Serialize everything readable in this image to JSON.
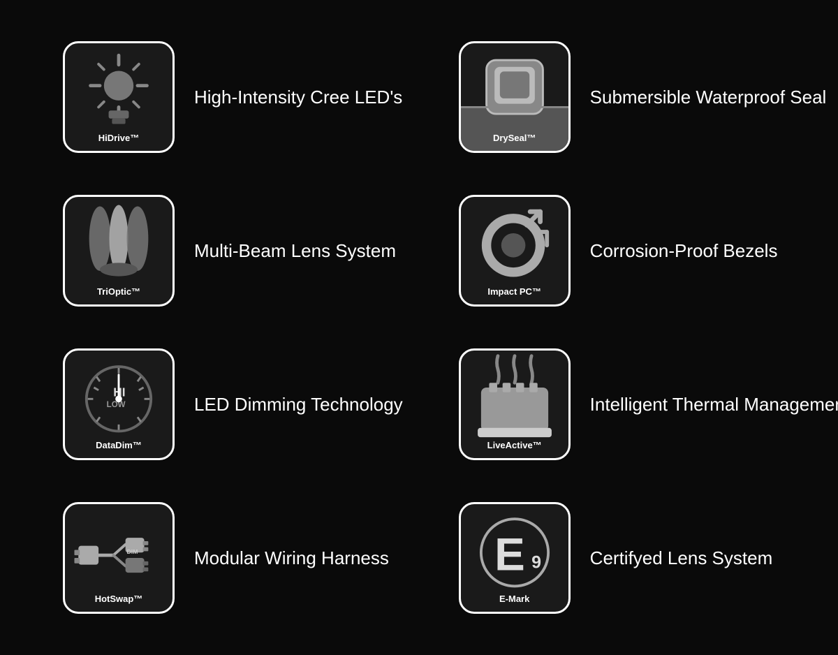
{
  "features": [
    {
      "id": "hidrive",
      "brand": "HiDrive™",
      "description": "High-Intensity Cree LED's"
    },
    {
      "id": "dryseal",
      "brand": "DrySeal™",
      "description": "Submersible Waterproof Seal"
    },
    {
      "id": "trioptic",
      "brand": "TriOptic™",
      "description": "Multi-Beam Lens System"
    },
    {
      "id": "impactpc",
      "brand": "Impact PC™",
      "description": "Corrosion-Proof Bezels"
    },
    {
      "id": "datadim",
      "brand": "DataDim™",
      "description": "LED Dimming Technology"
    },
    {
      "id": "liveactive",
      "brand": "LiveActive™",
      "description": "Intelligent Thermal Management"
    },
    {
      "id": "hotswap",
      "brand": "HotSwap™",
      "description": "Modular Wiring Harness"
    },
    {
      "id": "emark",
      "brand": "E-Mark",
      "description": "Certifyed Lens System"
    }
  ]
}
